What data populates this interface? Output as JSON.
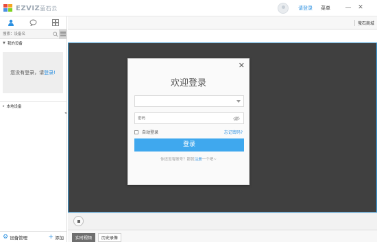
{
  "app": {
    "brand_text": "EZVIZ",
    "brand_cn": "萤石云",
    "login_link": "请登录",
    "menu_label": "菜单",
    "win_min": "—",
    "win_close": "✕"
  },
  "left_panel": {
    "search_placeholder": "搜索：设备名",
    "group_my_devices": "我的设备",
    "login_hint_prefix": "您没有登录，请",
    "login_hint_link": "登录",
    "login_hint_suffix": "!",
    "group_local_devices": "本地设备",
    "device_manage": "设备管理",
    "add": "添加"
  },
  "top_bar": {
    "mall": "萤石商城"
  },
  "mode_tabs": {
    "live": "实时视频",
    "playback": "历史录像"
  },
  "dialog": {
    "title": "欢迎登录",
    "password_placeholder": "密码",
    "auto_login": "自动登录",
    "forgot": "忘记密码?",
    "login_button": "登录",
    "reg_prefix": "你还没有账号？那就",
    "reg_link": "注册",
    "reg_suffix": "一个吧~"
  },
  "colors": {
    "accent": "#3fa8ee",
    "link": "#2a8fe0",
    "video_bg": "#404040"
  }
}
